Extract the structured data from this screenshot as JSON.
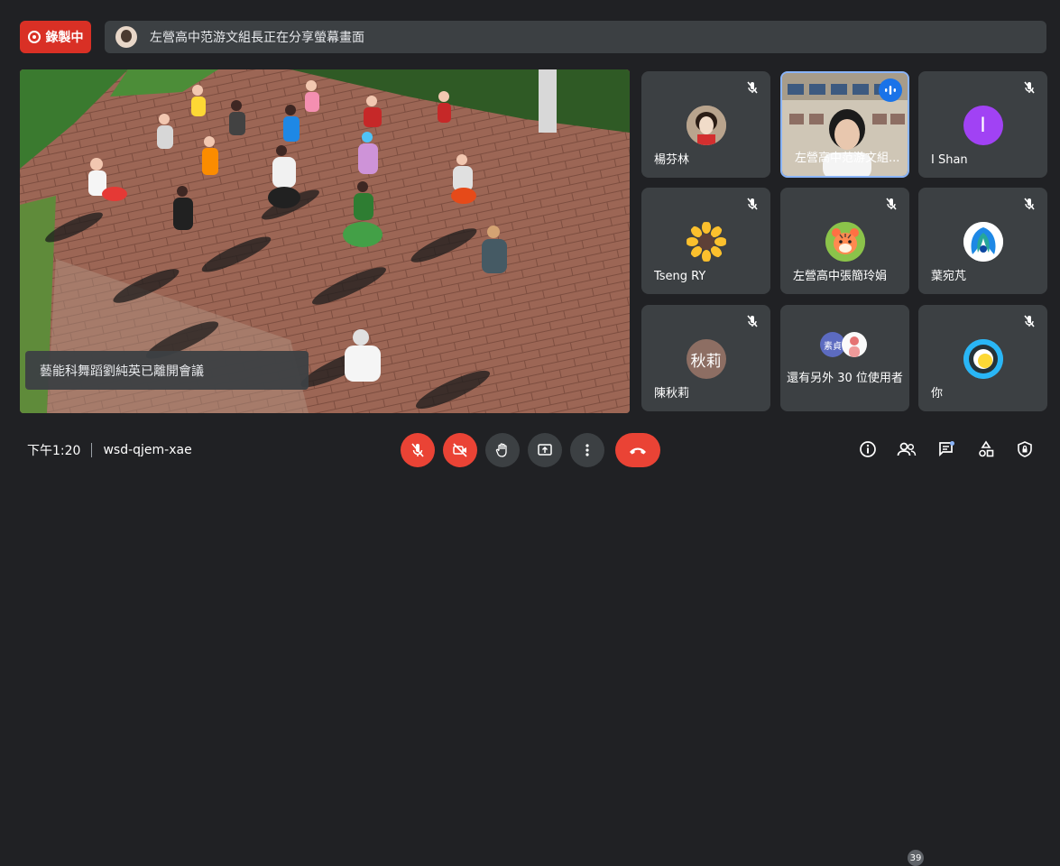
{
  "recording": {
    "label": "錄製中"
  },
  "share_banner": {
    "text": "左營高中范游文組長正在分享螢幕畫面"
  },
  "toast": {
    "text": "藝能科舞蹈劉純英已離開會議"
  },
  "participants": [
    {
      "name": "楊芬林",
      "avatar": "photo",
      "muted": true
    },
    {
      "name": "左營高中范游文組...",
      "avatar": "video",
      "muted": false,
      "speaking": true
    },
    {
      "name": "I Shan",
      "avatar": "letter",
      "letter": "I",
      "avatar_color": "#a142f4",
      "muted": true
    },
    {
      "name": "Tseng RY",
      "avatar": "sunflower-icon",
      "muted": true
    },
    {
      "name": "左營高中張簡玲娟",
      "avatar": "tiger-icon",
      "muted": true
    },
    {
      "name": "葉宛芃",
      "avatar": "peacock-icon",
      "muted": true
    },
    {
      "name": "陳秋莉",
      "avatar": "text",
      "avatar_text": "秋莉",
      "avatar_color": "#8d6e63",
      "muted": true
    },
    {
      "name": "還有另外 30 位使用者",
      "avatar": "group",
      "group_text": "素貞",
      "muted": false
    },
    {
      "name": "你",
      "avatar": "ring-icon",
      "muted": true
    }
  ],
  "bottom": {
    "time": "下午1:20",
    "meeting_code": "wsd-qjem-xae",
    "people_count": "39"
  },
  "colors": {
    "danger": "#ea4335",
    "accent": "#8ab4f8",
    "tile": "#3c4043",
    "bg": "#202124"
  }
}
